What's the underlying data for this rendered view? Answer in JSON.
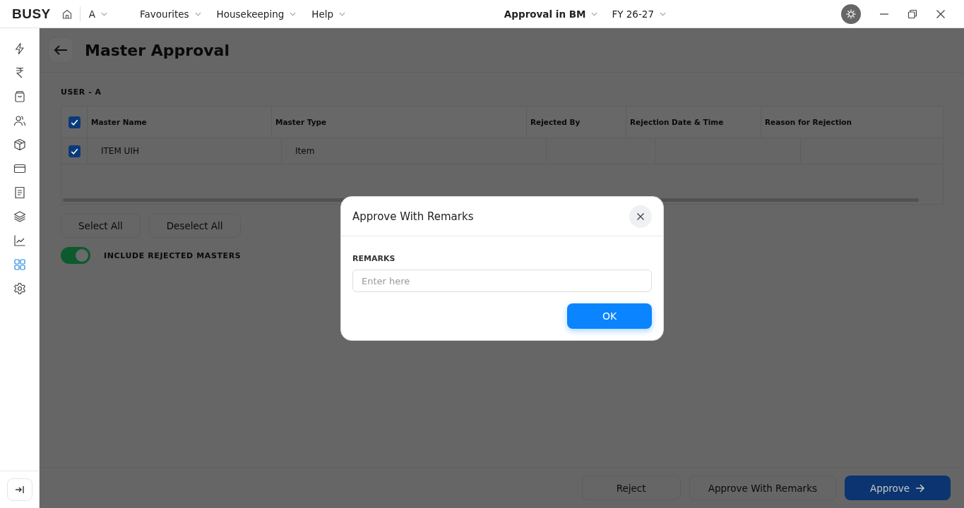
{
  "topbar": {
    "logo": "BUSY",
    "company": "A",
    "menus": [
      {
        "label": "Favourites"
      },
      {
        "label": "Housekeeping"
      },
      {
        "label": "Help"
      }
    ],
    "context": "Approval in BM",
    "fiscal_year": "FY 26-27"
  },
  "sidebar": {
    "items": [
      {
        "kind": "bolt",
        "selected": false
      },
      {
        "kind": "rupee",
        "selected": false
      },
      {
        "kind": "bag",
        "selected": false
      },
      {
        "kind": "users",
        "selected": false
      },
      {
        "kind": "box",
        "selected": false
      },
      {
        "kind": "card",
        "selected": false
      },
      {
        "kind": "receipt",
        "selected": false
      },
      {
        "kind": "layers",
        "selected": false
      },
      {
        "kind": "chart",
        "selected": false
      },
      {
        "kind": "grid",
        "selected": true
      },
      {
        "kind": "gear",
        "selected": false
      }
    ]
  },
  "page": {
    "title": "Master Approval",
    "user_label": "USER - A",
    "table": {
      "all_checked": true,
      "columns": [
        "Master Name",
        "Master Type",
        "Rejected By",
        "Rejection Date & Time",
        "Reason for Rejection"
      ],
      "rows": [
        {
          "checked": true,
          "cells": [
            "ITEM UIH",
            "Item",
            "",
            "",
            ""
          ]
        }
      ]
    },
    "select_all": "Select All",
    "deselect_all": "Deselect All",
    "include_rejected": {
      "label": "INCLUDE REJECTED MASTERS",
      "on": true
    },
    "footer_buttons": [
      {
        "label": "Reject",
        "kind": "secondary"
      },
      {
        "label": "Approve With Remarks",
        "kind": "secondary"
      },
      {
        "label": "Approve",
        "kind": "primary"
      }
    ]
  },
  "dialog": {
    "title": "Approve With Remarks",
    "field_label": "REMARKS",
    "placeholder": "Enter here",
    "ok": "OK"
  }
}
